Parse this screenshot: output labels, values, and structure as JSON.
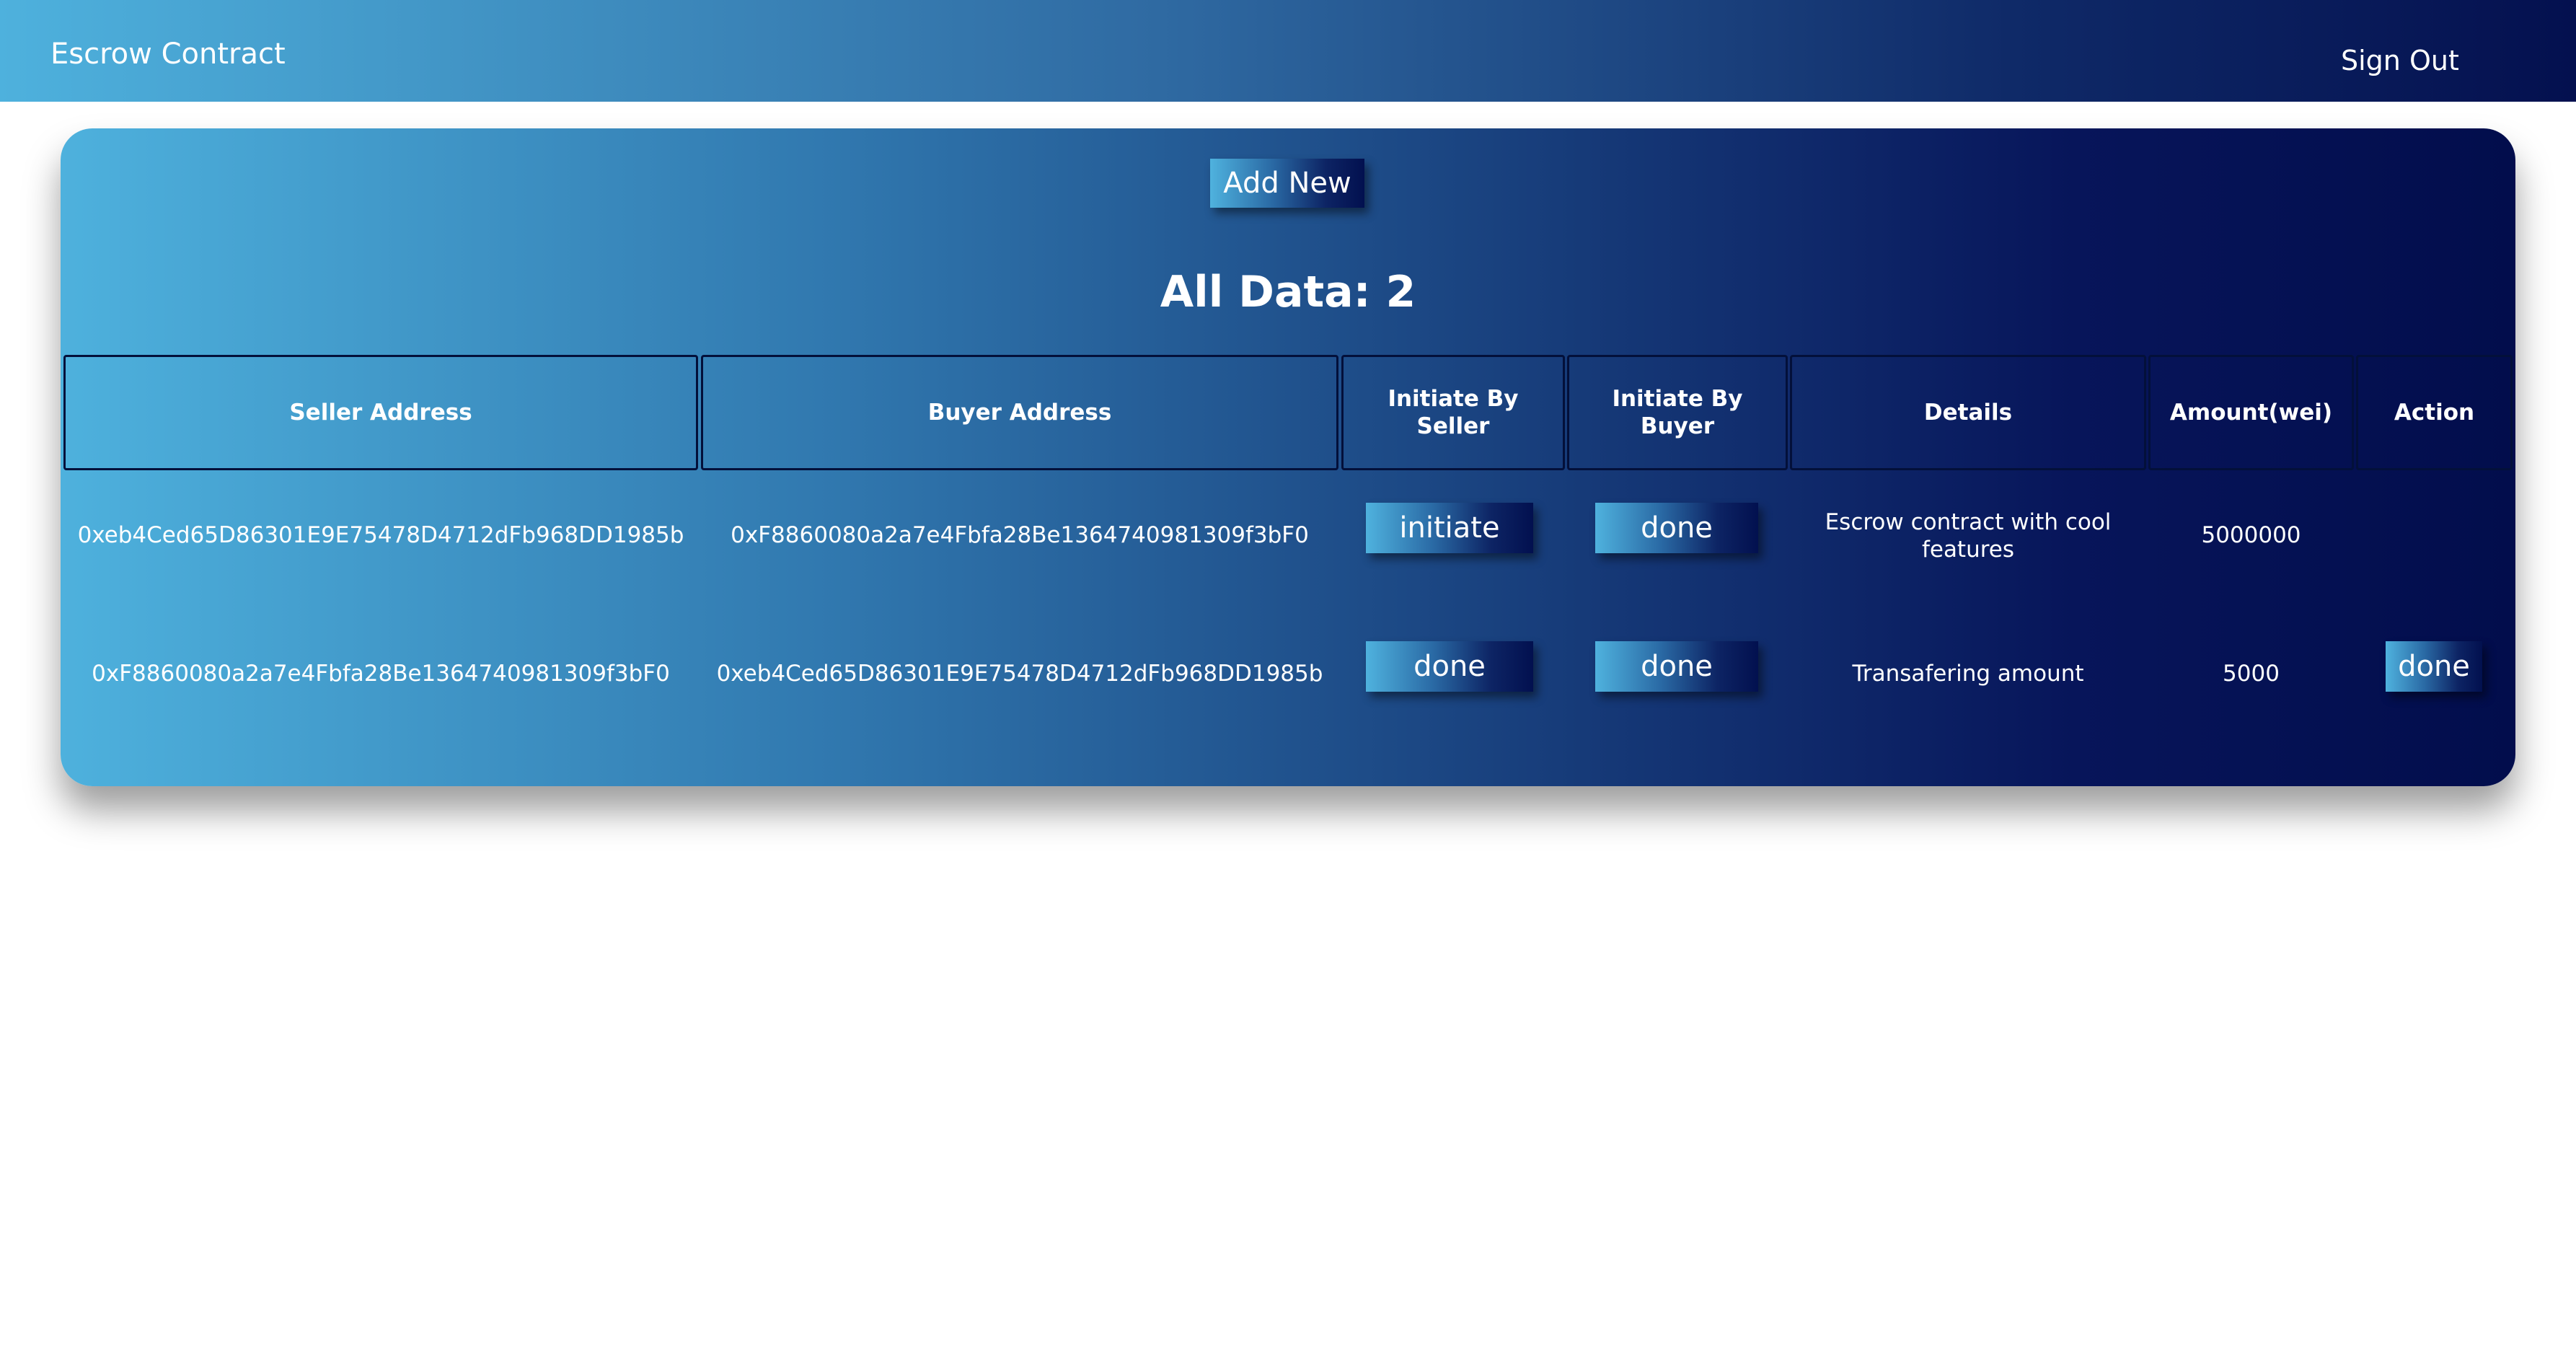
{
  "navbar": {
    "brand": "Escrow Contract",
    "sign_out": "Sign Out"
  },
  "card": {
    "add_new": "Add New",
    "all_data": "All Data: 2"
  },
  "table": {
    "headers": {
      "seller": "Seller Address",
      "buyer": "Buyer Address",
      "init_seller": "Initiate By Seller",
      "init_buyer": "Initiate By Buyer",
      "details": "Details",
      "amount": "Amount(wei)",
      "action": "Action"
    },
    "rows": [
      {
        "seller": "0xeb4Ced65D86301E9E75478D4712dFb968DD1985b",
        "buyer": "0xF8860080a2a7e4Fbfa28Be1364740981309f3bF0",
        "init_seller": "initiate",
        "init_buyer": "done",
        "details": "Escrow contract with cool features",
        "amount": "5000000",
        "action": ""
      },
      {
        "seller": "0xF8860080a2a7e4Fbfa28Be1364740981309f3bF0",
        "buyer": "0xeb4Ced65D86301E9E75478D4712dFb968DD1985b",
        "init_seller": "done",
        "init_buyer": "done",
        "details": "Transafering amount",
        "amount": "5000",
        "action": "done"
      }
    ]
  },
  "colors": {
    "gradient_start": "#4eb1dd",
    "gradient_end": "#020d4c",
    "header_border": "#03103a"
  }
}
